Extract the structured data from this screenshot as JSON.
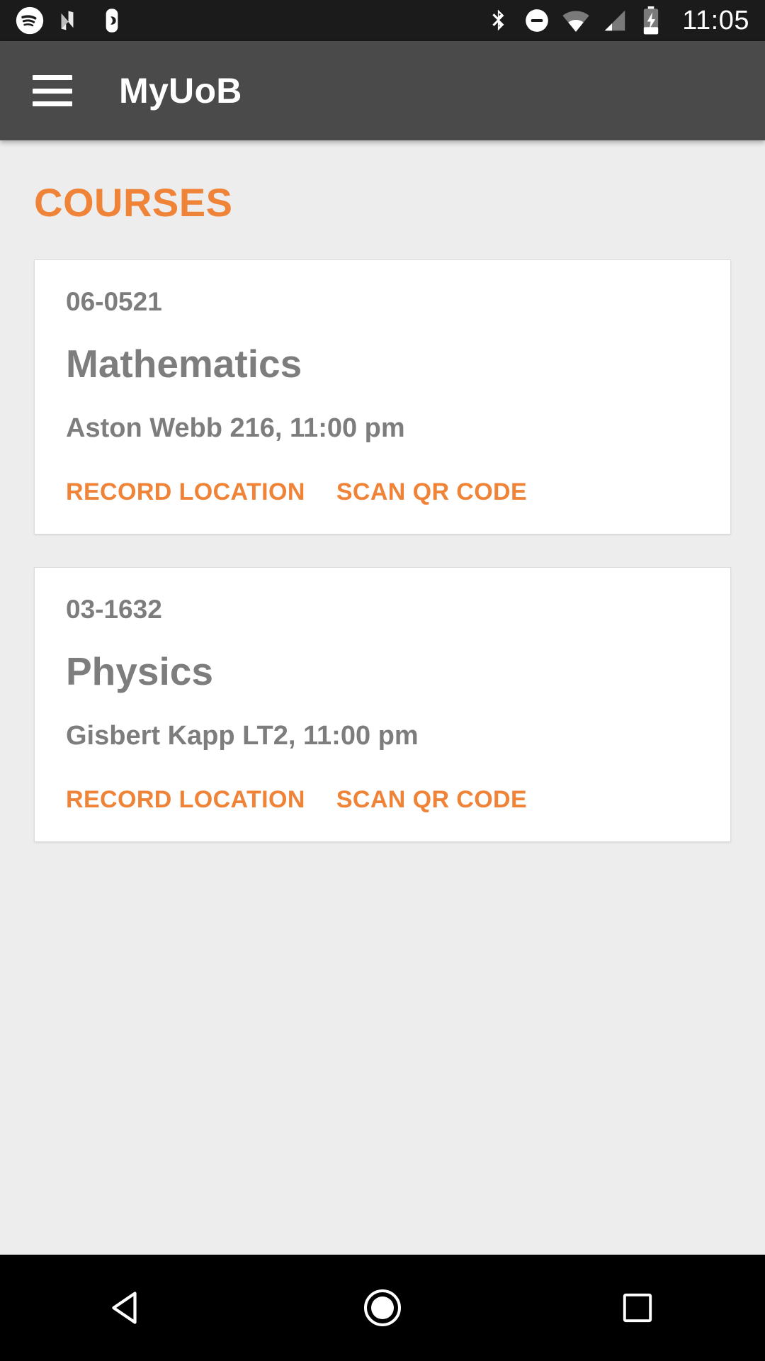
{
  "status_bar": {
    "left_icons": [
      "spotify-icon",
      "android-n-icon",
      "do-not-disturb-moon-icon"
    ],
    "right_icons": [
      "bluetooth-icon",
      "do-not-disturb-icon",
      "wifi-icon",
      "cellular-signal-icon",
      "battery-charging-icon"
    ],
    "time": "11:05"
  },
  "toolbar": {
    "menu_icon": "hamburger-menu-icon",
    "title": "MyUoB"
  },
  "main": {
    "section_title": "COURSES",
    "courses": [
      {
        "code": "06-0521",
        "name": "Mathematics",
        "meta": "Aston Webb 216, 11:00 pm",
        "action_record": "RECORD LOCATION",
        "action_scan": "SCAN QR CODE"
      },
      {
        "code": "03-1632",
        "name": "Physics",
        "meta": "Gisbert Kapp LT2, 11:00 pm",
        "action_record": "RECORD LOCATION",
        "action_scan": "SCAN QR CODE"
      }
    ]
  },
  "nav_bar": {
    "back_icon": "back-triangle-icon",
    "home_icon": "home-circle-icon",
    "recents_icon": "recents-square-icon"
  },
  "colors": {
    "accent": "#ef8337",
    "toolbar_bg": "#4a4a4a",
    "status_bg": "#1b1b1b",
    "page_bg": "#ededed",
    "card_bg": "#ffffff",
    "text_grey": "#7d7d7d"
  }
}
